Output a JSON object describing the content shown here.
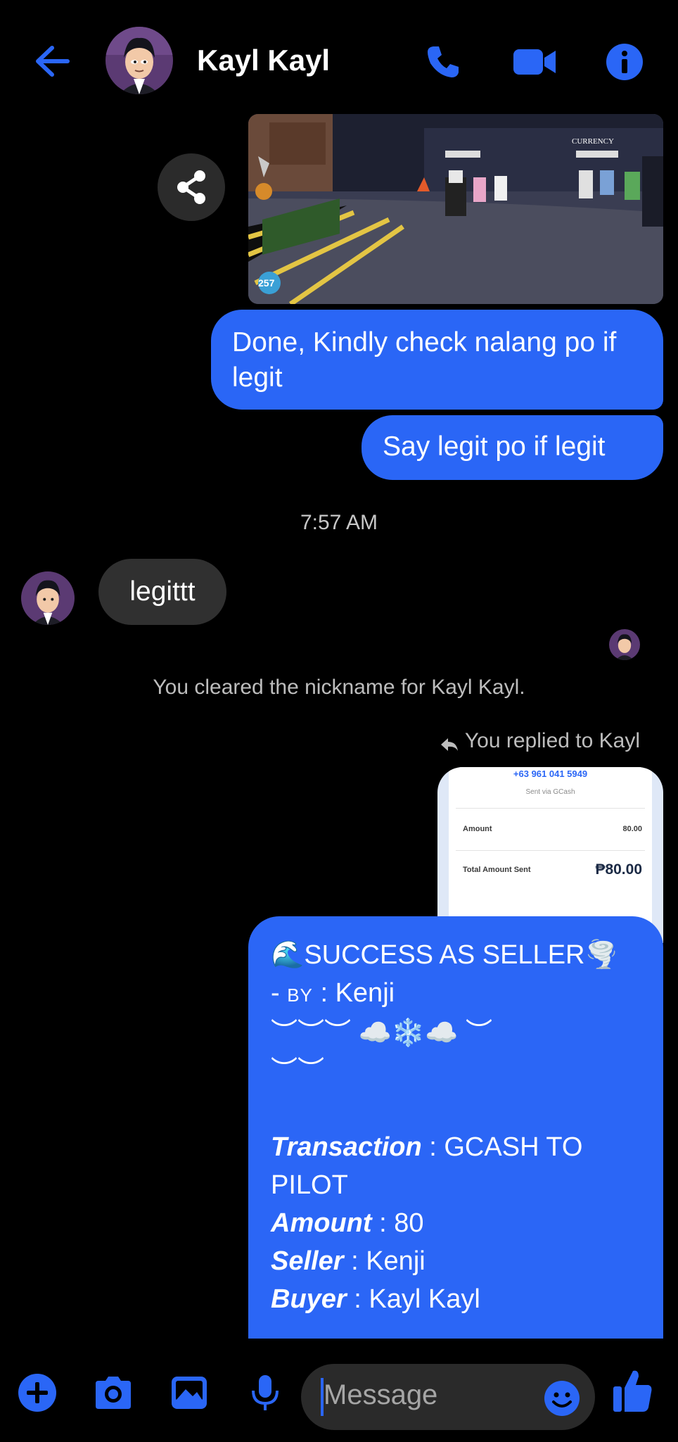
{
  "header": {
    "contact_name": "Kayl Kayl"
  },
  "screenshot_game": {
    "currency_label": "CURRENCY",
    "level_badge": "257"
  },
  "messages": {
    "out1": "Done, Kindly check nalang po if legit",
    "out2": "Say legit po if legit",
    "timestamp": "7:57 AM",
    "in1": "legittt",
    "system_notice": "You cleared the nickname for Kayl Kayl.",
    "reply_label": "You replied to Kayl"
  },
  "receipt": {
    "phone": "+63 961 041 5949",
    "sent_via": "Sent via GCash",
    "amount_label": "Amount",
    "amount_value": "80.00",
    "total_label": "Total Amount Sent",
    "total_value": "₱80.00"
  },
  "success_message": {
    "title": "🌊SUCCESS AS SELLER🌪️",
    "by_prefix": "- ",
    "by_label": "BY",
    "by_value": " : Kenji",
    "decor_line1": "︶︶︶ ☁️❄️☁️ ︶",
    "decor_line2": "︶︶",
    "transaction_label": "Transaction",
    "transaction_value": " : GCASH TO",
    "transaction_value2": "PILOT",
    "amount_label": "Amount",
    "amount_value": " : 80",
    "seller_label": "Seller",
    "seller_value": " : Kenji",
    "buyer_label": "Buyer",
    "buyer_value": " : Kayl Kayl"
  },
  "composer": {
    "placeholder": "Message"
  },
  "colors": {
    "accent": "#2a66f6",
    "background": "#000000",
    "incoming_bubble": "#303030"
  },
  "icons": [
    "back-arrow-icon",
    "phone-icon",
    "video-icon",
    "info-icon",
    "share-icon",
    "reply-icon",
    "plus-icon",
    "camera-icon",
    "gallery-icon",
    "microphone-icon",
    "emoji-icon",
    "thumbs-up-icon"
  ]
}
